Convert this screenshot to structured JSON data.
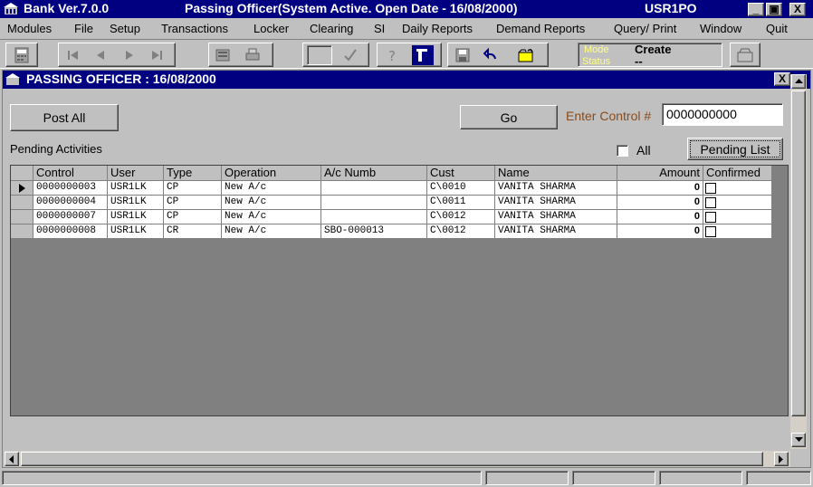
{
  "app": {
    "title": "Bank Ver.7.0.0",
    "window_title": "Passing Officer(System Active. Open Date - 16/08/2000)",
    "user": "USR1PO",
    "minimize": "_",
    "restore": "▣",
    "close": "X"
  },
  "menu": [
    "Modules",
    "File",
    "Setup",
    "Transactions",
    "Locker",
    "Clearing",
    "SI",
    "Daily Reports",
    "Demand Reports",
    "Query/ Print",
    "Window",
    "Quit"
  ],
  "toolbar": {
    "mode_label": "Mode",
    "mode_value": "Create",
    "status_label": "Status",
    "status_value": "--"
  },
  "child": {
    "title": "PASSING OFFICER : 16/08/2000",
    "close": "X"
  },
  "actions": {
    "post_all": "Post All",
    "go": "Go",
    "control_label": "Enter Control #",
    "control_value": "0000000000",
    "pending_title": "Pending Activities",
    "all_label": "All",
    "pending_list": "Pending List"
  },
  "grid": {
    "columns": [
      "Control",
      "User",
      "Type",
      "Operation",
      "A/c Numb",
      "Cust",
      "Name",
      "Amount",
      "Confirmed"
    ],
    "rows": [
      {
        "control": "0000000003",
        "user": "USR1LK",
        "type": "CP",
        "operation": "New A/c",
        "acnumb": "",
        "cust": "C\\0010",
        "name": "VANITA SHARMA",
        "amount": "0"
      },
      {
        "control": "0000000004",
        "user": "USR1LK",
        "type": "CP",
        "operation": "New A/c",
        "acnumb": "",
        "cust": "C\\0011",
        "name": "VANITA SHARMA",
        "amount": "0"
      },
      {
        "control": "0000000007",
        "user": "USR1LK",
        "type": "CP",
        "operation": "New A/c",
        "acnumb": "",
        "cust": "C\\0012",
        "name": "VANITA SHARMA",
        "amount": "0"
      },
      {
        "control": "0000000008",
        "user": "USR1LK",
        "type": "CR",
        "operation": "New A/c",
        "acnumb": "SBO-000013",
        "cust": "C\\0012",
        "name": "VANITA SHARMA",
        "amount": "0"
      }
    ]
  }
}
